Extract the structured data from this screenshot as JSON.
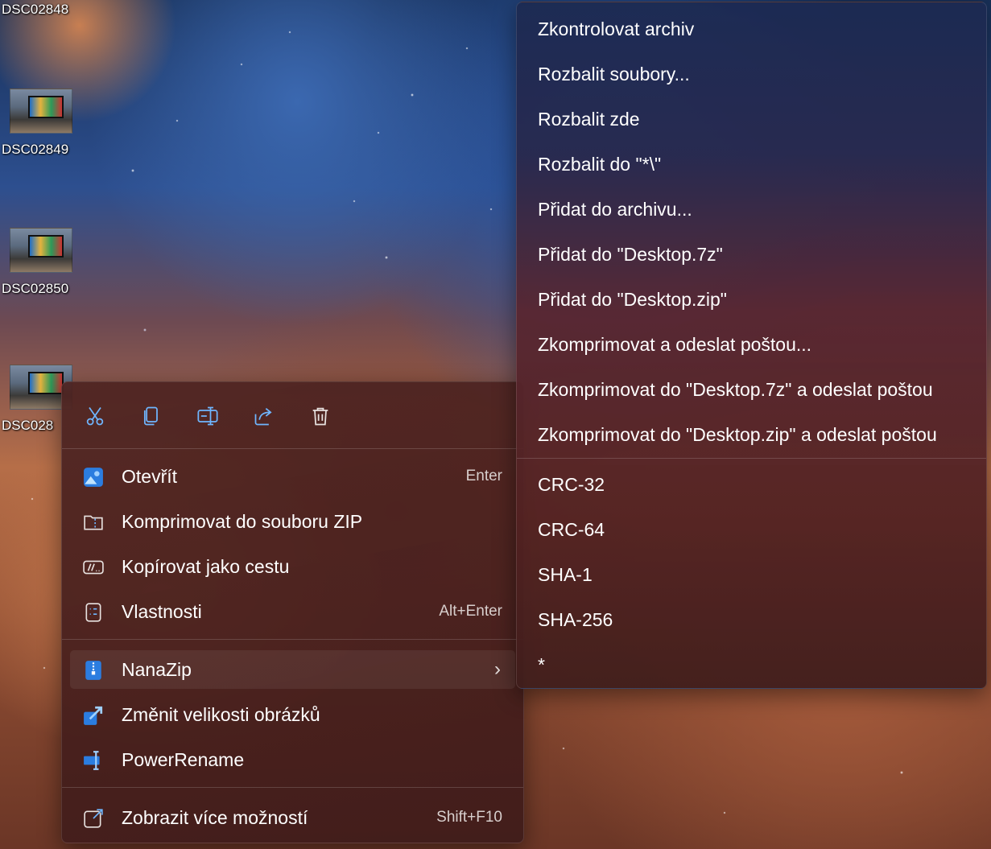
{
  "desktop": {
    "icons": [
      {
        "label": "DSC02848"
      },
      {
        "label": "DSC02849"
      },
      {
        "label": "DSC02850"
      },
      {
        "label": "DSC028"
      }
    ]
  },
  "context_menu": {
    "toolbar": [
      {
        "name": "cut-icon"
      },
      {
        "name": "copy-icon"
      },
      {
        "name": "rename-icon"
      },
      {
        "name": "share-icon"
      },
      {
        "name": "delete-icon"
      }
    ],
    "items": [
      {
        "label": "Otevřít",
        "shortcut": "Enter",
        "icon": "photos-app-icon"
      },
      {
        "label": "Komprimovat do souboru ZIP",
        "shortcut": "",
        "icon": "zip-folder-icon"
      },
      {
        "label": "Kopírovat jako cestu",
        "shortcut": "",
        "icon": "copy-path-icon"
      },
      {
        "label": "Vlastnosti",
        "shortcut": "Alt+Enter",
        "icon": "properties-icon"
      },
      {
        "label": "NanaZip",
        "shortcut": "",
        "icon": "nanazip-icon",
        "has_submenu": true
      },
      {
        "label": "Změnit velikosti obrázků",
        "shortcut": "",
        "icon": "image-resizer-icon"
      },
      {
        "label": "PowerRename",
        "shortcut": "",
        "icon": "powerrename-icon"
      },
      {
        "label": "Zobrazit více možností",
        "shortcut": "Shift+F10",
        "icon": "more-options-icon"
      }
    ]
  },
  "nanazip_submenu": {
    "items": [
      "Zkontrolovat archiv",
      "Rozbalit soubory...",
      "Rozbalit zde",
      "Rozbalit do \"*\\\"",
      "Přidat do archivu...",
      "Přidat do \"Desktop.7z\"",
      "Přidat do \"Desktop.zip\"",
      "Zkomprimovat a odeslat poštou...",
      "Zkomprimovat do \"Desktop.7z\" a odeslat poštou",
      "Zkomprimovat do \"Desktop.zip\" a odeslat poštou"
    ],
    "hash_items": [
      "CRC-32",
      "CRC-64",
      "SHA-1",
      "SHA-256",
      "*"
    ]
  },
  "colors": {
    "menu_text": "#ffffff",
    "accent_blue": "#2b7de0"
  }
}
